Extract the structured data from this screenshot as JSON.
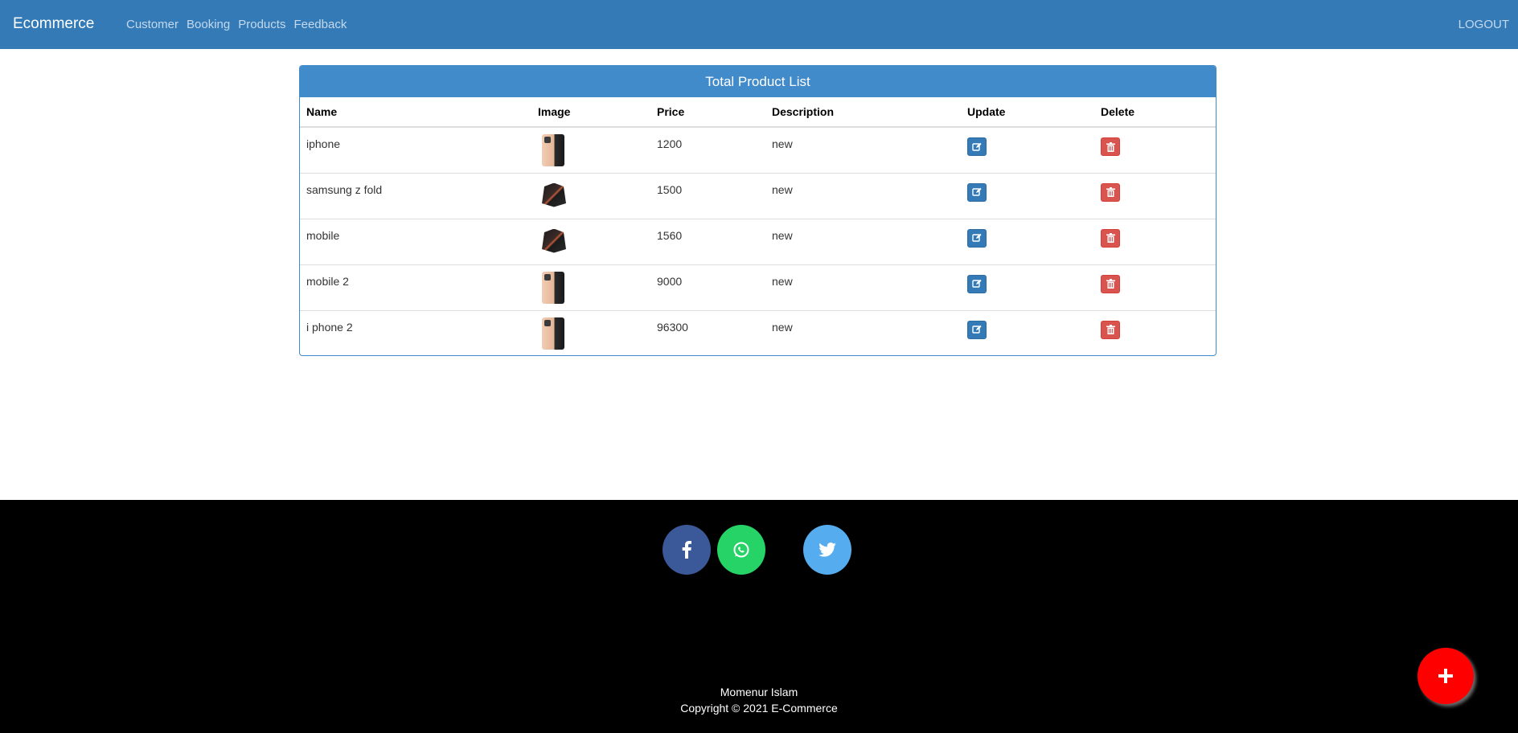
{
  "navbar": {
    "brand": "Ecommerce",
    "links": [
      "Customer",
      "Booking",
      "Products",
      "Feedback"
    ],
    "logout": "LOGOUT"
  },
  "panel": {
    "title": "Total Product List",
    "headers": [
      "Name",
      "Image",
      "Price",
      "Description",
      "Update",
      "Delete"
    ],
    "rows": [
      {
        "name": "iphone",
        "image": "phone-thumbnail",
        "price": "1200",
        "description": "new"
      },
      {
        "name": "samsung z fold",
        "image": "fold-thumbnail",
        "price": "1500",
        "description": "new"
      },
      {
        "name": "mobile",
        "image": "fold-thumbnail",
        "price": "1560",
        "description": "new"
      },
      {
        "name": "mobile 2",
        "image": "phone-thumbnail",
        "price": "9000",
        "description": "new"
      },
      {
        "name": "i phone 2",
        "image": "phone-thumbnail",
        "price": "96300",
        "description": "new"
      }
    ],
    "update_icon": "edit-icon",
    "delete_icon": "trash-icon"
  },
  "footer": {
    "social": [
      "facebook-icon",
      "whatsapp-icon",
      "twitter-icon"
    ],
    "author": "Momenur Islam",
    "copyright": "Copyright © 2021 E-Commerce"
  },
  "fab": {
    "icon": "plus-icon"
  },
  "colors": {
    "navbar": "#337ab7",
    "panel_heading": "#428bca",
    "update_button": "#337ab7",
    "delete_button": "#d9534f",
    "footer": "#000000",
    "facebook": "#3b5998",
    "whatsapp": "#25d366",
    "twitter": "#55acee",
    "fab": "#ff0000"
  }
}
